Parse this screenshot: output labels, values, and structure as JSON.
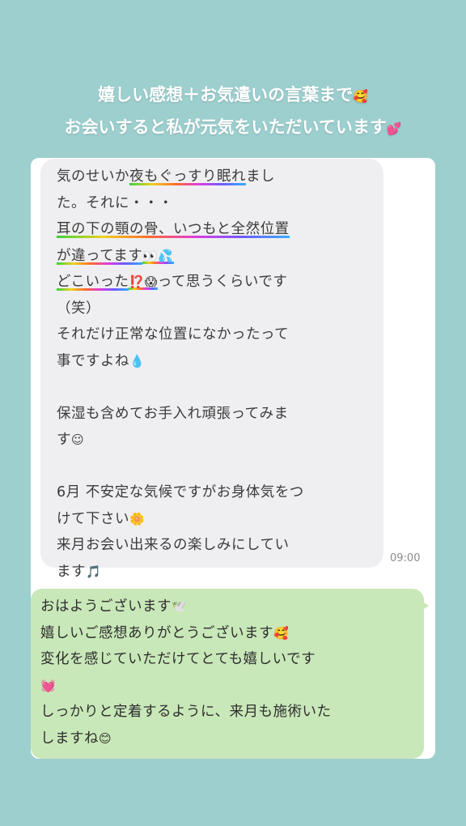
{
  "header": {
    "line1": "嬉しい感想＋お気遣いの言葉まで",
    "line1_emoji": "🥰",
    "line2": "お会いすると私が元気をいただいています",
    "line2_emoji": "💕"
  },
  "incoming": {
    "lines": {
      "l1a": "気のせいか",
      "l1b": "夜もぐっすり眠れ",
      "l1c": "まし",
      "l2": "た。それに・・・",
      "l3": "耳の下の顎の骨、いつもと全然位置",
      "l4": "が違ってます",
      "l4e": "👀💦",
      "l5": "どこいった",
      "l5e": "⁉️😱",
      "l5b": "って思うくらいです",
      "l6": "（笑）",
      "l7": "それだけ正常な位置になかったって",
      "l8": "事ですよね",
      "l8e": "💧",
      "l9": "保湿も含めてお手入れ頑張ってみま",
      "l10": "す",
      "l10e": "☺",
      "l11": "6月 不安定な気候ですがお身体気をつ",
      "l12": "けて下さい",
      "l12e": "🌼",
      "l13": "来月お会い出来るの楽しみにしてい",
      "l14": "ます",
      "l14e": "🎵"
    },
    "time": "09:00"
  },
  "outgoing": {
    "lines": {
      "o1": "おはようございます",
      "o1e": "🕊️",
      "o2": "嬉しいご感想ありがとうございます",
      "o2e": "🥰",
      "o3": "変化を感じていただけてとても嬉しいです",
      "o4e": "💓",
      "o5": "しっかりと定着するように、来月も施術いた",
      "o6": "しますね",
      "o6e": "😊"
    }
  }
}
